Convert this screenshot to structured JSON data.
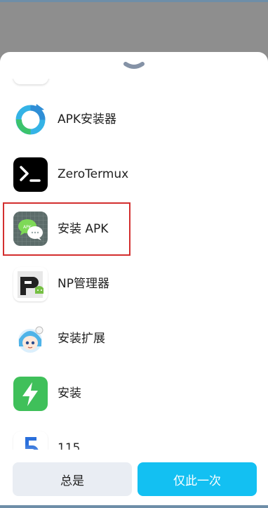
{
  "sheet": {
    "collapse_icon": "chevron-down-icon"
  },
  "apps": [
    {
      "label": "APK安装器",
      "icon": "apk-installer-icon"
    },
    {
      "label": "ZeroTermux",
      "icon": "terminal-icon"
    },
    {
      "label": "安装 APK",
      "icon": "install-apk-icon",
      "selected": true
    },
    {
      "label": "NP管理器",
      "icon": "np-manager-icon"
    },
    {
      "label": "安装扩展",
      "icon": "install-extension-icon"
    },
    {
      "label": "安装",
      "icon": "lightning-install-icon"
    },
    {
      "label": "115",
      "icon": "115-icon"
    }
  ],
  "buttons": {
    "always": "总是",
    "just_once": "仅此一次"
  },
  "colors": {
    "selection_outline": "#d32f2f",
    "primary_button": "#13c0f2",
    "secondary_button": "#e9edf3"
  }
}
